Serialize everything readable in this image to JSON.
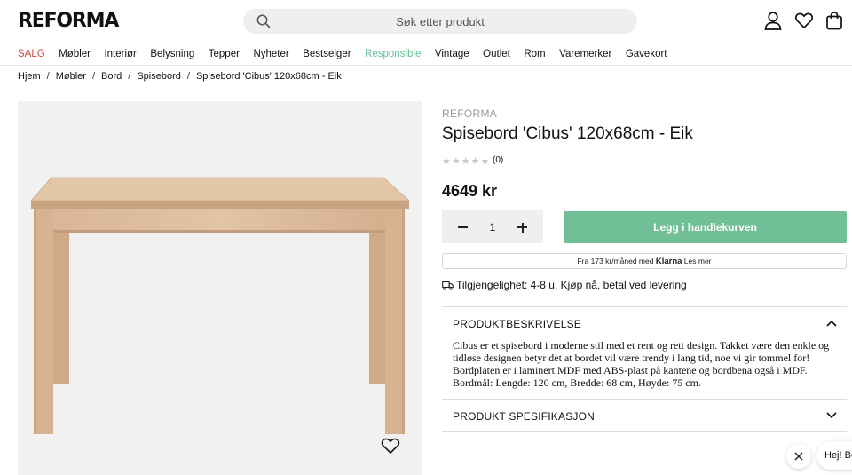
{
  "header": {
    "logo": "REFORMA",
    "search_placeholder": "Søk etter produkt",
    "icons": [
      "search-icon",
      "account-icon",
      "heart-icon",
      "bag-icon"
    ]
  },
  "nav": {
    "items": [
      "SALG",
      "Møbler",
      "Interiør",
      "Belysning",
      "Tepper",
      "Nyheter",
      "Bestselger",
      "Responsible",
      "Vintage",
      "Outlet",
      "Rom",
      "Varemerker",
      "Gavekort"
    ],
    "sale_color": "#d0463f",
    "responsible_color": "#5fbf96"
  },
  "breadcrumb": [
    "Hjem",
    "Møbler",
    "Bord",
    "Spisebord",
    "Spisebord 'Cibus' 120x68cm - Eik"
  ],
  "product": {
    "brand": "REFORMA",
    "title": "Spisebord 'Cibus' 120x68cm - Eik",
    "rating_stars": 0,
    "rating_count": "(0)",
    "price": "4649 kr",
    "quantity": "1",
    "add_to_cart": "Legg i handlekurven",
    "cart_color": "#71bf96",
    "klarna_prefix": "Fra 173 kr/måned med",
    "klarna_brand": "Klarna",
    "klarna_link": "Les mer",
    "availability": "Tilgjengelighet: 4-8 u. Kjøp nå, betal ved levering"
  },
  "accordion": {
    "description_title": "PRODUKTBESKRIVELSE",
    "description_lines": [
      "Cibus er et spisebord i moderne stil med et rent og rett design. Takket være den enkle og",
      "tidløse designen betyr det at bordet vil være trendy i lang tid, noe vi gir tommel for!",
      "Bordplaten er i laminert MDF med ABS-plast på kantene og bordbena også i MDF.",
      "Bordmål: Lengde: 120 cm, Bredde: 68 cm, Høyde: 75 cm."
    ],
    "spec_title": "PRODUKT SPESIFIKASJON"
  },
  "chat": {
    "greeting": "Hej! Be"
  }
}
